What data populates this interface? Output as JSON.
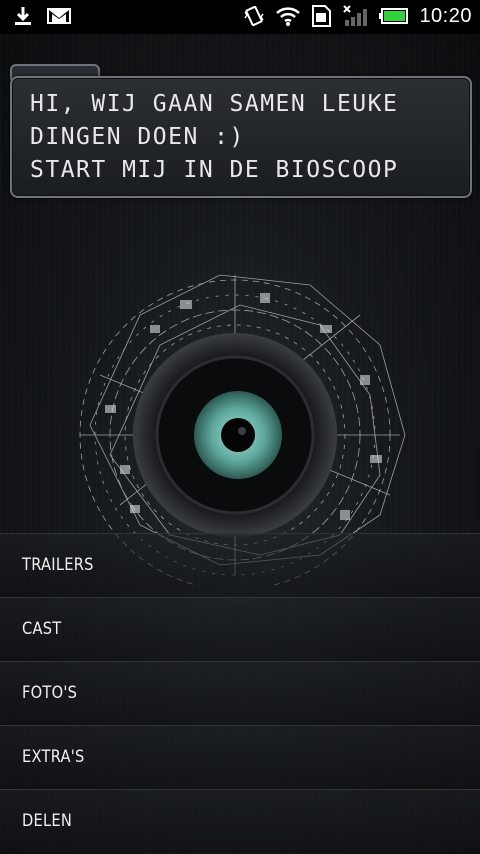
{
  "status_bar": {
    "time": "10:20",
    "icons_left": [
      "download-icon",
      "gmail-icon"
    ],
    "icons_right": [
      "vibrate-icon",
      "wifi-icon",
      "sim-icon",
      "signal-icon",
      "battery-icon"
    ]
  },
  "bubble": {
    "text": "HI, WIJ GAAN SAMEN LEUKE\nDINGEN DOEN :)\nSTART MIJ IN DE BIOSCOOP"
  },
  "menu": {
    "items": [
      {
        "label": "TRAILERS"
      },
      {
        "label": "CAST"
      },
      {
        "label": "FOTO'S"
      },
      {
        "label": "EXTRA'S"
      },
      {
        "label": "DELEN"
      }
    ]
  },
  "colors": {
    "background": "#0d0f11",
    "iris": "#5fa89c",
    "text": "#f0f0f0"
  }
}
